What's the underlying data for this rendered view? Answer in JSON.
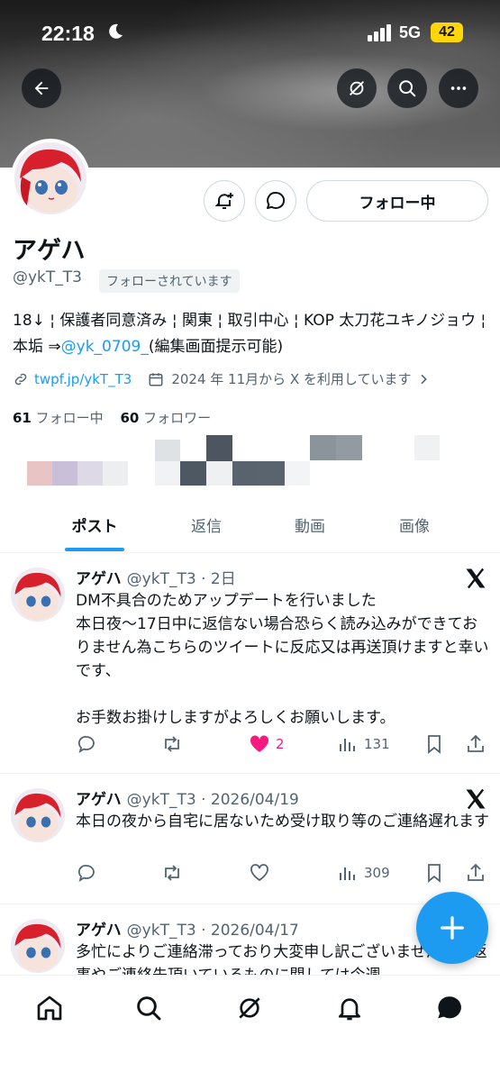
{
  "status_bar": {
    "time": "22:18",
    "network": "5G",
    "battery": "42"
  },
  "profile": {
    "name": "アゲハ",
    "handle": "@ykT_T3",
    "follows_you": "フォローされています",
    "follow_button": "フォロー中",
    "bio_text": "18↓ ¦ 保護者同意済み ¦ 関東 ¦ 取引中心 ¦ KOP 太刀花ユキノジョウ ¦ 本垢 ⇒",
    "bio_mention": "@yk_0709_",
    "bio_suffix": "(編集画面提示可能)",
    "link": "twpf.jp/ykT_T3",
    "joined": "2024 年 11月から X を利用しています",
    "following_count": "61",
    "following_label": "フォロー中",
    "followers_count": "60",
    "followers_label": "フォロワー"
  },
  "tabs": [
    {
      "label": "ポスト",
      "active": true
    },
    {
      "label": "返信",
      "active": false
    },
    {
      "label": "動画",
      "active": false
    },
    {
      "label": "画像",
      "active": false
    }
  ],
  "posts": [
    {
      "name": "アゲハ",
      "meta": "@ykT_T3 · 2日",
      "text": "DM不具合のためアップデートを行いました\n本日夜～17日中に返信ない場合恐らく読み込みができておりません為こちらのツイートに反応又は再送頂けますと幸いです、\n\nお手数お掛けしますがよろしくお願いします。",
      "likes": "2",
      "views": "131",
      "liked": true
    },
    {
      "name": "アゲハ",
      "meta": "@ykT_T3 · 2026/04/19",
      "text": "本日の夜から自宅に居ないため受け取り等のご連絡遅れます",
      "likes": "",
      "views": "309",
      "liked": false
    },
    {
      "name": "アゲハ",
      "meta": "@ykT_T3 · 2026/04/17",
      "text": "多忙によりご連絡滞っており大変申し訳ございません。お返事やご連絡先頂いているものに関しては今週",
      "likes": "",
      "views": "",
      "liked": false
    }
  ],
  "colors": {
    "accent": "#1d9bf0",
    "like": "#f91880",
    "muted": "#536471"
  },
  "icons": [
    "back-arrow-icon",
    "grok-icon",
    "search-icon",
    "more-icon",
    "notification-bell-icon",
    "message-icon",
    "link-icon",
    "calendar-icon",
    "x-logo-icon",
    "reply-icon",
    "repost-icon",
    "like-icon",
    "views-icon",
    "bookmark-icon",
    "share-icon",
    "compose-icon",
    "home-icon",
    "explore-icon",
    "grok-nav-icon",
    "notifications-icon",
    "messages-icon"
  ]
}
